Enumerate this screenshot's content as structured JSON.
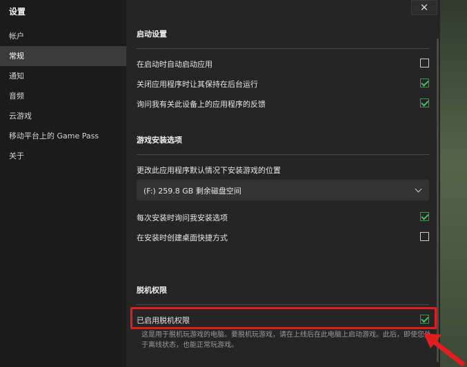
{
  "sidebar": {
    "title": "设置",
    "items": [
      {
        "label": "帐户",
        "active": false
      },
      {
        "label": "常规",
        "active": true
      },
      {
        "label": "通知",
        "active": false
      },
      {
        "label": "音频",
        "active": false
      },
      {
        "label": "云游戏",
        "active": false
      },
      {
        "label": "移动平台上的 Game Pass",
        "active": false
      },
      {
        "label": "关于",
        "active": false
      }
    ]
  },
  "window": {
    "close_glyph": "✕"
  },
  "startup": {
    "title": "启动设置",
    "items": [
      {
        "label": "在启动时自动启动应用",
        "checked": false
      },
      {
        "label": "关闭应用程序时让其保持在后台运行",
        "checked": true
      },
      {
        "label": "询问我有关此设备上的应用程序的反馈",
        "checked": true
      }
    ]
  },
  "install": {
    "title": "游戏安装选项",
    "location_label": "更改此应用程序默认情况下安装游戏的位置",
    "dropdown_value": "(F:) 259.8 GB 剩余磁盘空间",
    "items": [
      {
        "label": "每次安装时询问我安装选项",
        "checked": true
      },
      {
        "label": "在安装时创建桌面快捷方式",
        "checked": false
      }
    ]
  },
  "offline": {
    "title": "脱机权限",
    "toggle": {
      "label": "已启用脱机权限",
      "checked": true
    },
    "description": "这是用于脱机玩游戏的电脑。要脱机玩游戏，请在上线后在此电脑上启动游戏。此后，即使您处于离线状态，也能正常玩游戏。"
  },
  "colors": {
    "highlight": "#e11d1d",
    "check": "#45c259"
  }
}
